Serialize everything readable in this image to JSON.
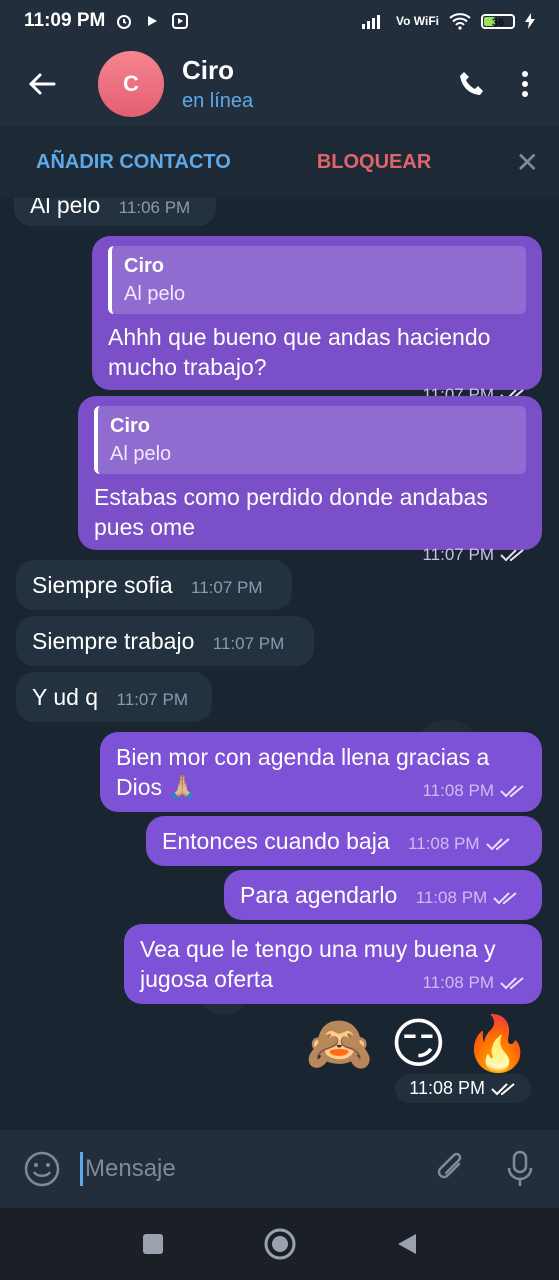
{
  "status_bar": {
    "time": "11:09 PM",
    "network": "Vo WiFi",
    "battery": "36"
  },
  "header": {
    "avatar_letter": "C",
    "name": "Ciro",
    "status": "en línea"
  },
  "actions": {
    "add_contact": "AÑADIR CONTACTO",
    "block": "BLOQUEAR"
  },
  "messages": [
    {
      "text": "Al pelo",
      "time": "11:06 PM"
    },
    {
      "reply_name": "Ciro",
      "reply_text": "Al pelo",
      "text": "Ahhh que bueno que andas haciendo mucho trabajo?",
      "time": "11:07 PM"
    },
    {
      "reply_name": "Ciro",
      "reply_text": "Al pelo",
      "text": "Estabas como perdido donde andabas pues ome",
      "time": "11:07 PM"
    },
    {
      "text": "Siempre sofia",
      "time": "11:07 PM"
    },
    {
      "text": "Siempre trabajo",
      "time": "11:07 PM"
    },
    {
      "text": "Y ud q",
      "time": "11:07 PM"
    },
    {
      "text": "Bien mor con agenda llena gracias a Dios 🙏🏼",
      "time": "11:08 PM"
    },
    {
      "text": "Entonces cuando baja",
      "time": "11:08 PM"
    },
    {
      "text": "Para agendarlo",
      "time": "11:08 PM"
    },
    {
      "text": "Vea que le tengo una muy buena y jugosa oferta",
      "time": "11:08 PM"
    },
    {
      "emojis": "🙈 😏 🔥",
      "time": "11:08 PM"
    }
  ],
  "composer": {
    "placeholder": "Mensaje"
  },
  "colors": {
    "accent": "#5ea9e8",
    "danger": "#e0656a",
    "outgoing": "#7b4fc7",
    "incoming": "#243140"
  }
}
